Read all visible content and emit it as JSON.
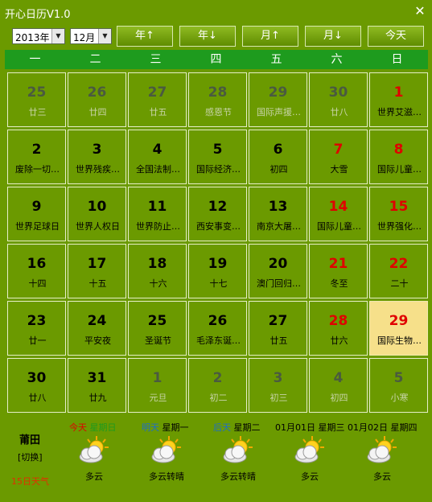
{
  "window": {
    "title": "开心日历V1.0",
    "close_icon": "close-icon"
  },
  "toolbar": {
    "year_value": "2013年",
    "month_value": "12月",
    "buttons": [
      "年↑",
      "年↓",
      "月↑",
      "月↓",
      "今天"
    ]
  },
  "weekdays": [
    "一",
    "二",
    "三",
    "四",
    "五",
    "六",
    "日"
  ],
  "calendar": {
    "weeks": [
      [
        {
          "day": "25",
          "lunar": "廿三",
          "state": "other"
        },
        {
          "day": "26",
          "lunar": "廿四",
          "state": "other"
        },
        {
          "day": "27",
          "lunar": "廿五",
          "state": "other"
        },
        {
          "day": "28",
          "lunar": "感恩节",
          "state": "other"
        },
        {
          "day": "29",
          "lunar": "国际声援…",
          "state": "other"
        },
        {
          "day": "30",
          "lunar": "廿八",
          "state": "other"
        },
        {
          "day": "1",
          "lunar": "世界艾滋…",
          "state": "weekend"
        }
      ],
      [
        {
          "day": "2",
          "lunar": "废除一切…",
          "state": ""
        },
        {
          "day": "3",
          "lunar": "世界残疾…",
          "state": ""
        },
        {
          "day": "4",
          "lunar": "全国法制…",
          "state": ""
        },
        {
          "day": "5",
          "lunar": "国际经济…",
          "state": ""
        },
        {
          "day": "6",
          "lunar": "初四",
          "state": ""
        },
        {
          "day": "7",
          "lunar": "大雪",
          "state": "weekend"
        },
        {
          "day": "8",
          "lunar": "国际儿童…",
          "state": "weekend"
        }
      ],
      [
        {
          "day": "9",
          "lunar": "世界足球日",
          "state": ""
        },
        {
          "day": "10",
          "lunar": "世界人权日",
          "state": ""
        },
        {
          "day": "11",
          "lunar": "世界防止…",
          "state": ""
        },
        {
          "day": "12",
          "lunar": "西安事变…",
          "state": ""
        },
        {
          "day": "13",
          "lunar": "南京大屠…",
          "state": ""
        },
        {
          "day": "14",
          "lunar": "国际儿童…",
          "state": "weekend"
        },
        {
          "day": "15",
          "lunar": "世界强化…",
          "state": "weekend"
        }
      ],
      [
        {
          "day": "16",
          "lunar": "十四",
          "state": ""
        },
        {
          "day": "17",
          "lunar": "十五",
          "state": ""
        },
        {
          "day": "18",
          "lunar": "十六",
          "state": ""
        },
        {
          "day": "19",
          "lunar": "十七",
          "state": ""
        },
        {
          "day": "20",
          "lunar": "澳门回归…",
          "state": ""
        },
        {
          "day": "21",
          "lunar": "冬至",
          "state": "weekend"
        },
        {
          "day": "22",
          "lunar": "二十",
          "state": "weekend"
        }
      ],
      [
        {
          "day": "23",
          "lunar": "廿一",
          "state": ""
        },
        {
          "day": "24",
          "lunar": "平安夜",
          "state": ""
        },
        {
          "day": "25",
          "lunar": "圣诞节",
          "state": ""
        },
        {
          "day": "26",
          "lunar": "毛泽东诞…",
          "state": ""
        },
        {
          "day": "27",
          "lunar": "廿五",
          "state": ""
        },
        {
          "day": "28",
          "lunar": "廿六",
          "state": "weekend"
        },
        {
          "day": "29",
          "lunar": "国际生物…",
          "state": "today"
        }
      ],
      [
        {
          "day": "30",
          "lunar": "廿八",
          "state": ""
        },
        {
          "day": "31",
          "lunar": "廿九",
          "state": ""
        },
        {
          "day": "1",
          "lunar": "元旦",
          "state": "other"
        },
        {
          "day": "2",
          "lunar": "初二",
          "state": "other"
        },
        {
          "day": "3",
          "lunar": "初三",
          "state": "other"
        },
        {
          "day": "4",
          "lunar": "初四",
          "state": "other"
        },
        {
          "day": "5",
          "lunar": "小寒",
          "state": "other"
        }
      ]
    ]
  },
  "weather": {
    "city": "莆田",
    "switch_label": "[切换]",
    "days_label": "15日天气",
    "icon": "partly-cloudy-sun-icon",
    "forecast": [
      {
        "prefix": "今天",
        "prefix_color": "#e00000",
        "label": "星期日",
        "label_color": "#1e9b1e",
        "text": "多云"
      },
      {
        "prefix": "明天",
        "prefix_color": "#1e6ec8",
        "label": "星期一",
        "label_color": "#000000",
        "text": "多云转晴"
      },
      {
        "prefix": "后天",
        "prefix_color": "#1e6ec8",
        "label": "星期二",
        "label_color": "#000000",
        "text": "多云转晴"
      },
      {
        "prefix": "01月01日",
        "prefix_color": "#000000",
        "label": "星期三",
        "label_color": "#000000",
        "text": "多云"
      },
      {
        "prefix": "01月02日",
        "prefix_color": "#000000",
        "label": "星期四",
        "label_color": "#000000",
        "text": "多云"
      }
    ]
  }
}
